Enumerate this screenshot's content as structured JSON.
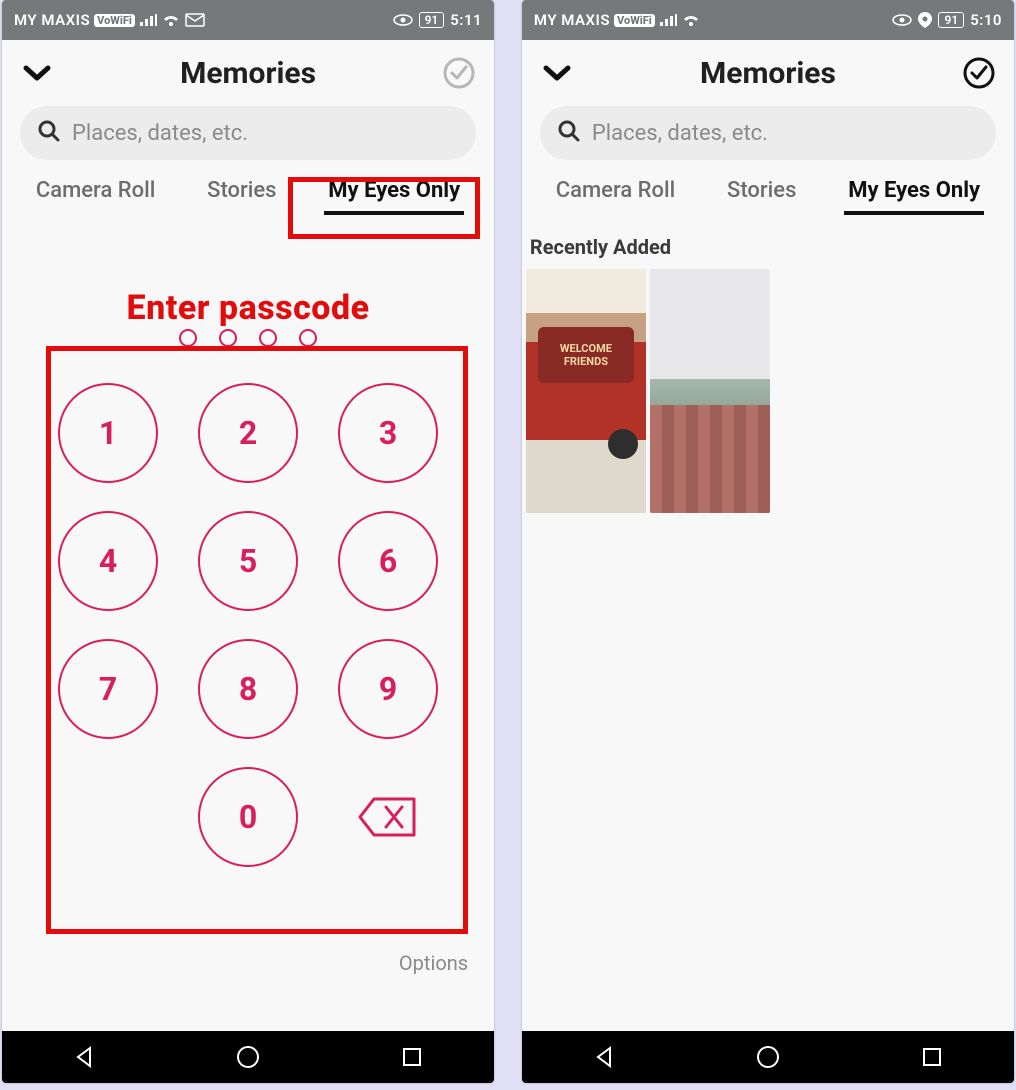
{
  "left": {
    "statusbar": {
      "carrier": "MY MAXIS",
      "vowifi": "VoWiFi",
      "battery_pct": "91",
      "time": "5:11"
    },
    "header": {
      "title": "Memories"
    },
    "search": {
      "placeholder": "Places, dates, etc."
    },
    "tabs": {
      "camera_roll": "Camera Roll",
      "stories": "Stories",
      "my_eyes_only": "My Eyes Only",
      "active": "my_eyes_only"
    },
    "annotations": {
      "enter": "Enter passcode"
    },
    "keypad": {
      "digits": [
        "1",
        "2",
        "3",
        "4",
        "5",
        "6",
        "7",
        "8",
        "9",
        "0"
      ],
      "options": "Options"
    }
  },
  "right": {
    "statusbar": {
      "carrier": "MY MAXIS",
      "vowifi": "VoWiFi",
      "battery_pct": "91",
      "time": "5:10"
    },
    "header": {
      "title": "Memories"
    },
    "search": {
      "placeholder": "Places, dates, etc."
    },
    "tabs": {
      "camera_roll": "Camera Roll",
      "stories": "Stories",
      "my_eyes_only": "My Eyes Only",
      "active": "my_eyes_only"
    },
    "section": {
      "title": "Recently Added"
    },
    "thumbs": {
      "t1_line1": "WELCOME",
      "t1_line2": "FRIENDS"
    }
  }
}
